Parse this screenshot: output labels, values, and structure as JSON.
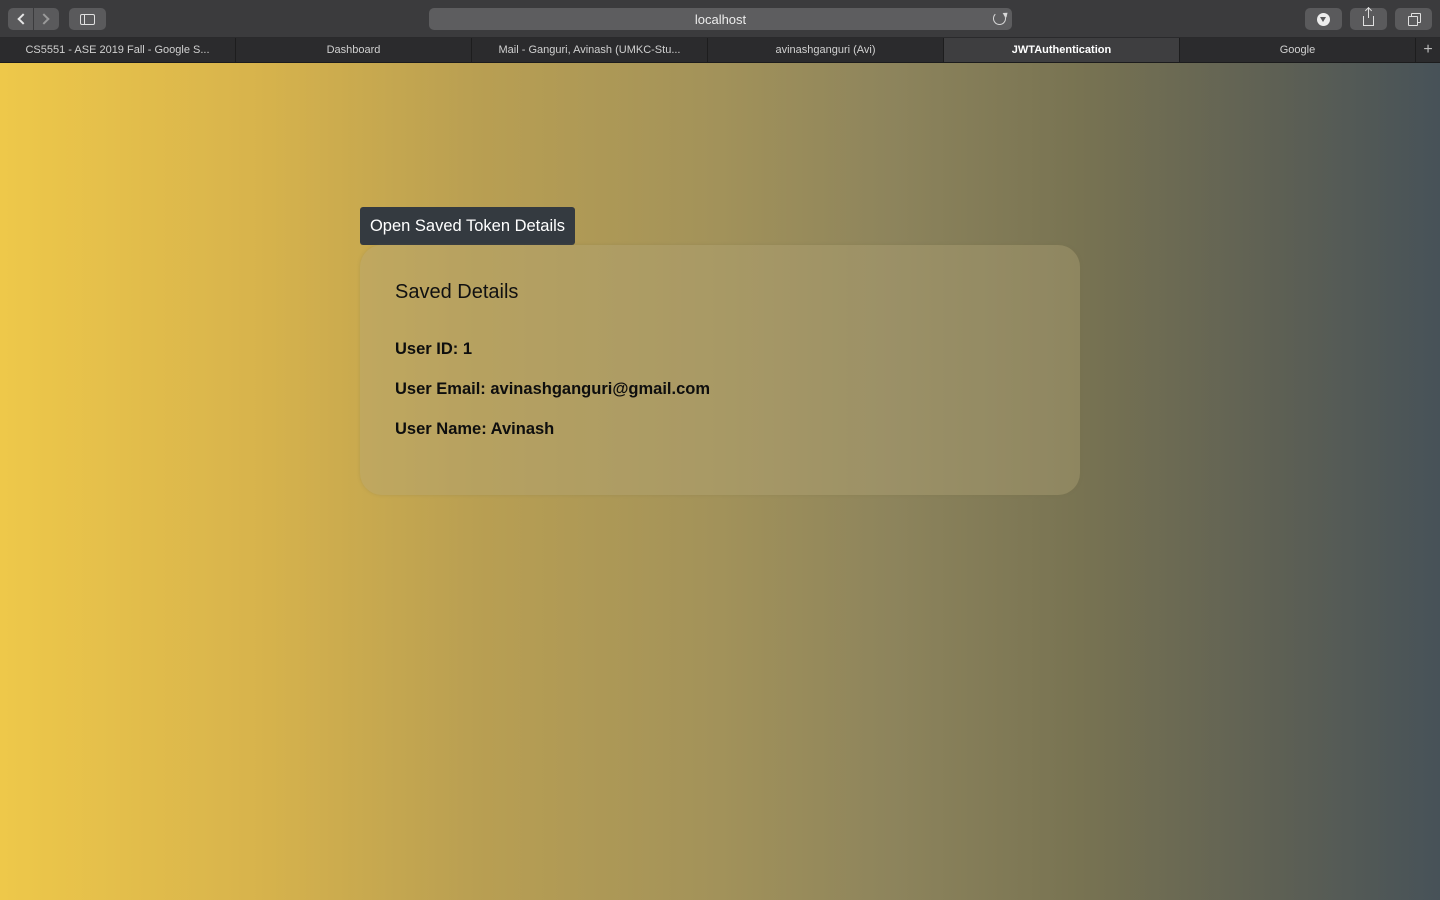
{
  "browser": {
    "address": "localhost",
    "tabs": [
      {
        "label": "CS5551 - ASE 2019 Fall - Google S..."
      },
      {
        "label": "Dashboard"
      },
      {
        "label": "Mail - Ganguri, Avinash (UMKC-Stu..."
      },
      {
        "label": "avinashganguri (Avi)"
      },
      {
        "label": "JWTAuthentication",
        "active": true
      },
      {
        "label": "Google"
      }
    ],
    "new_tab_glyph": "+"
  },
  "page": {
    "open_button_label": "Open Saved Token Details",
    "card_title": "Saved Details",
    "user_id_line": "User ID: 1",
    "user_email_line": "User Email: avinashganguri@gmail.com",
    "user_name_line": "User Name: Avinash"
  },
  "colors": {
    "gradient_start": "#eec84a",
    "gradient_end": "#475258",
    "button_bg": "#343a40"
  }
}
